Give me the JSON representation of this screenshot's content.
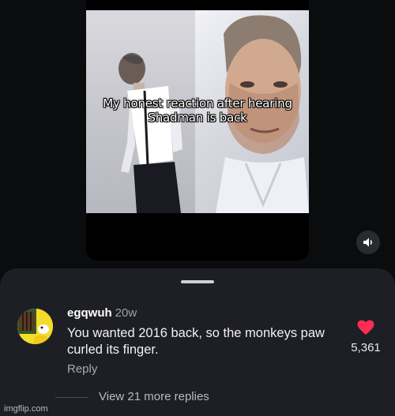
{
  "meme": {
    "caption_line1": "My honest reaction after hearing",
    "caption_line2": "Shadman is back"
  },
  "video": {
    "mute_icon": "speaker-muted-icon"
  },
  "comment": {
    "username": "egqwuh",
    "age": "20w",
    "text": "You wanted 2016 back, so the monkeys paw curled its finger.",
    "reply_label": "Reply",
    "like_count": "5,361",
    "like_icon": "heart-icon",
    "like_color": "#ff2d55"
  },
  "thread": {
    "view_replies_label": "View 21 more replies"
  },
  "watermark": "imgflip.com"
}
